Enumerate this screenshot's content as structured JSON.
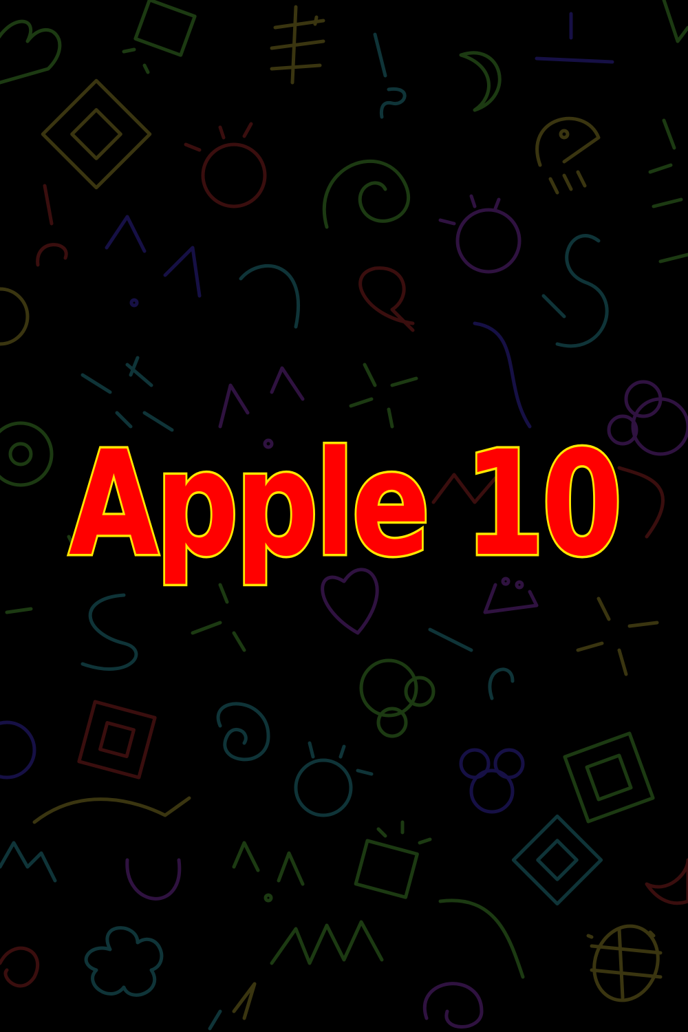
{
  "title": {
    "text": "Apple 10"
  },
  "colors": {
    "background": "#000000",
    "title_fill": "#ff0000",
    "title_outline": "#ffe600",
    "doodle_green": "#1c3a12",
    "doodle_olive": "#3a3510",
    "doodle_teal": "#0f3438",
    "doodle_purple": "#2f1240",
    "doodle_red": "#3a0e0e",
    "doodle_navy": "#161045"
  }
}
